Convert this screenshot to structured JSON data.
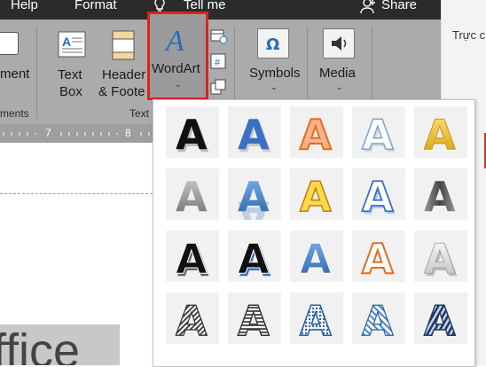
{
  "tabs": [
    {
      "label": "Help"
    },
    {
      "label": "Format"
    }
  ],
  "tell_me": {
    "label": "Tell me"
  },
  "share": {
    "label": "Share"
  },
  "ribbon": {
    "partial_left_button": "ment",
    "text_box": {
      "line1": "Text",
      "line2": "Box"
    },
    "header_footer": {
      "line1": "Header",
      "line2": "& Foote"
    },
    "wordart": {
      "label": "WordArt"
    },
    "symbols": {
      "label": "Symbols"
    },
    "media": {
      "label": "Media"
    },
    "groups": {
      "left_partial": "ments",
      "text": "Text"
    }
  },
  "ruler": {
    "marks": [
      "7",
      "8"
    ]
  },
  "document": {
    "text": "ffice"
  },
  "side_pane": {
    "text": "Trực c"
  },
  "wordart_gallery": {
    "letter": "A",
    "styles": [
      "fill-black-text1-shadow",
      "fill-blue-accent1-shadow",
      "fill-orange-accent2-outline",
      "fill-white-outline-accent1-shadow",
      "fill-gold-accent4-soft-bevel",
      "gradient-gray-text",
      "gradient-blue-reflection",
      "fill-gold-accent4-outline",
      "fill-white-outline-accent1-glow",
      "gradient-dark-gray",
      "fill-black-white-shadow",
      "fill-black-blue-offset-shadow",
      "fill-blue-accent1-bevel",
      "fill-white-outline-accent2",
      "fill-light-gray-shadow",
      "pattern-dark-gray-stripes",
      "pattern-gray-stripes",
      "pattern-blue-dots",
      "pattern-blue-stripes",
      "pattern-navy-dashes"
    ]
  },
  "colors": {
    "titlebar": "#2b2b2b",
    "ribbon": "#ababab",
    "highlight_border": "#e02020",
    "wordart_icon": "#2b6cb5"
  },
  "icons": [
    "lightbulb-icon",
    "person-icon",
    "omega-icon",
    "speaker-icon",
    "wordart-a-icon",
    "date-time-icon",
    "field-icon",
    "object-icon",
    "textbox-icon",
    "header-footer-icon"
  ]
}
